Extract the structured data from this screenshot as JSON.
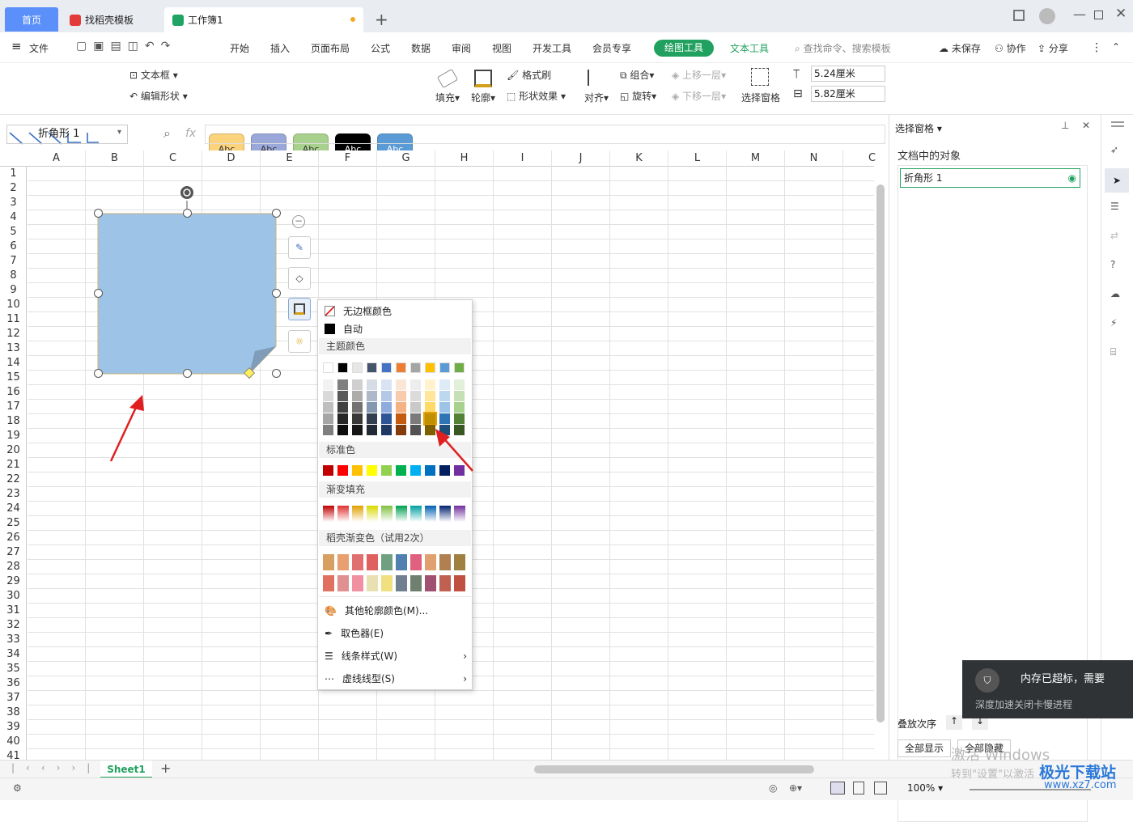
{
  "tabs": {
    "home": "首页",
    "template": "找稻壳模板",
    "workbook": "工作簿1"
  },
  "menu": {
    "file": "文件",
    "start": "开始",
    "insert": "插入",
    "layout": "页面布局",
    "formula": "公式",
    "data": "数据",
    "review": "审阅",
    "view": "视图",
    "dev": "开发工具",
    "member": "会员专享",
    "draw_tools": "绘图工具",
    "text_tools": "文本工具",
    "search": "查找命令、搜索模板",
    "unsaved": "未保存",
    "collab": "协作",
    "share": "分享"
  },
  "ribbon": {
    "textbox": "文本框",
    "edit_shape": "编辑形状",
    "style_labels": [
      "Abc",
      "Abc",
      "Abc",
      "Abc",
      "Abc"
    ],
    "style_colors": [
      "#fbd37d",
      "#9aa7d9",
      "#a9d18e",
      "#000000",
      "#5b9bd5"
    ],
    "fill": "填充",
    "outline": "轮廓",
    "format_brush": "格式刷",
    "shape_effect": "形状效果",
    "align": "对齐",
    "group": "组合",
    "rotate": "旋转",
    "bring_forward": "上移一层",
    "send_back": "下移一层",
    "selection_pane": "选择窗格",
    "height": "5.24厘米",
    "width": "5.82厘米"
  },
  "namebox": "折角形 1",
  "fx": "fx",
  "columns": [
    "A",
    "B",
    "C",
    "D",
    "E",
    "F",
    "G",
    "H",
    "I",
    "J",
    "K",
    "L",
    "M",
    "N",
    "C"
  ],
  "rows": [
    "1",
    "2",
    "3",
    "4",
    "5",
    "6",
    "7",
    "8",
    "9",
    "10",
    "11",
    "12",
    "13",
    "14",
    "15",
    "16",
    "17",
    "18",
    "19",
    "20",
    "21",
    "22",
    "23",
    "24",
    "25",
    "26",
    "27",
    "28",
    "29",
    "30",
    "31",
    "32",
    "33",
    "34",
    "35",
    "36",
    "37",
    "38",
    "39",
    "40",
    "41"
  ],
  "popup": {
    "no_border": "无边框颜色",
    "auto": "自动",
    "theme_title": "主题颜色",
    "theme_top": [
      "#ffffff",
      "#000000",
      "#e7e6e6",
      "#44546a",
      "#4472c4",
      "#ed7d31",
      "#a5a5a5",
      "#ffc000",
      "#5b9bd5",
      "#70ad47"
    ],
    "theme_shades": [
      [
        "#f2f2f2",
        "#7f7f7f",
        "#d0cece",
        "#d6dce5",
        "#dae3f3",
        "#fbe5d6",
        "#ededed",
        "#fff2cc",
        "#deebf7",
        "#e2f0d9"
      ],
      [
        "#d9d9d9",
        "#595959",
        "#aeabab",
        "#adb9ca",
        "#b4c7e7",
        "#f8cbad",
        "#dbdbdb",
        "#ffe699",
        "#bdd7ee",
        "#c5e0b4"
      ],
      [
        "#bfbfbf",
        "#404040",
        "#757171",
        "#8497b0",
        "#8faadc",
        "#f4b183",
        "#c9c9c9",
        "#ffd966",
        "#9dc3e6",
        "#a9d18e"
      ],
      [
        "#a6a6a6",
        "#262626",
        "#3a3838",
        "#333f50",
        "#2f5597",
        "#c55a11",
        "#7b7b7b",
        "#bf9000",
        "#2e75b6",
        "#538135"
      ],
      [
        "#7f7f7f",
        "#0d0d0d",
        "#171616",
        "#222a35",
        "#203864",
        "#843c0c",
        "#525252",
        "#7f6000",
        "#1f4e79",
        "#385723"
      ]
    ],
    "standard_title": "标准色",
    "standard": [
      "#c00000",
      "#ff0000",
      "#ffc000",
      "#ffff00",
      "#92d050",
      "#00b050",
      "#00b0f0",
      "#0070c0",
      "#002060",
      "#7030a0"
    ],
    "gradient_title": "渐变填充",
    "gradient": [
      "#c00000",
      "#e03030",
      "#e0a000",
      "#d8d800",
      "#80c040",
      "#00a050",
      "#00a0a0",
      "#0060b0",
      "#002070",
      "#7030a0"
    ],
    "daoke_title": "稻壳渐变色（试用2次）",
    "daoke_row1": [
      "#d8a060",
      "#e8a070",
      "#e07070",
      "#e06060",
      "#70a080",
      "#5080b0",
      "#e06080",
      "#e0a070",
      "#b08050",
      "#a08040"
    ],
    "daoke_row2": [
      "#e07060",
      "#e09090",
      "#f090a0",
      "#e8e0b0",
      "#f0e080",
      "#708090",
      "#708070",
      "#a05070",
      "#c06050",
      "#c05040"
    ],
    "more_colors": "其他轮廓颜色(M)...",
    "picker": "取色器(E)",
    "line_style": "线条样式(W)",
    "dash_style": "虚线线型(S)"
  },
  "pane": {
    "title": "选择窗格",
    "objects_title": "文档中的对象",
    "object": "折角形 1",
    "stack_order": "叠放次序",
    "show_all": "全部显示",
    "hide_all": "全部隐藏"
  },
  "sheet": {
    "name": "Sheet1",
    "add": "+"
  },
  "status": {
    "zoom": "100%"
  },
  "toast": {
    "title": "内存已超标，需要",
    "sub": "深度加速关闭卡慢进程"
  },
  "watermark": {
    "activate": "激活 Windows",
    "goto": "转到\"设置\"以激活",
    "brand": "极光下载站",
    "url": "www.xz7.com"
  }
}
